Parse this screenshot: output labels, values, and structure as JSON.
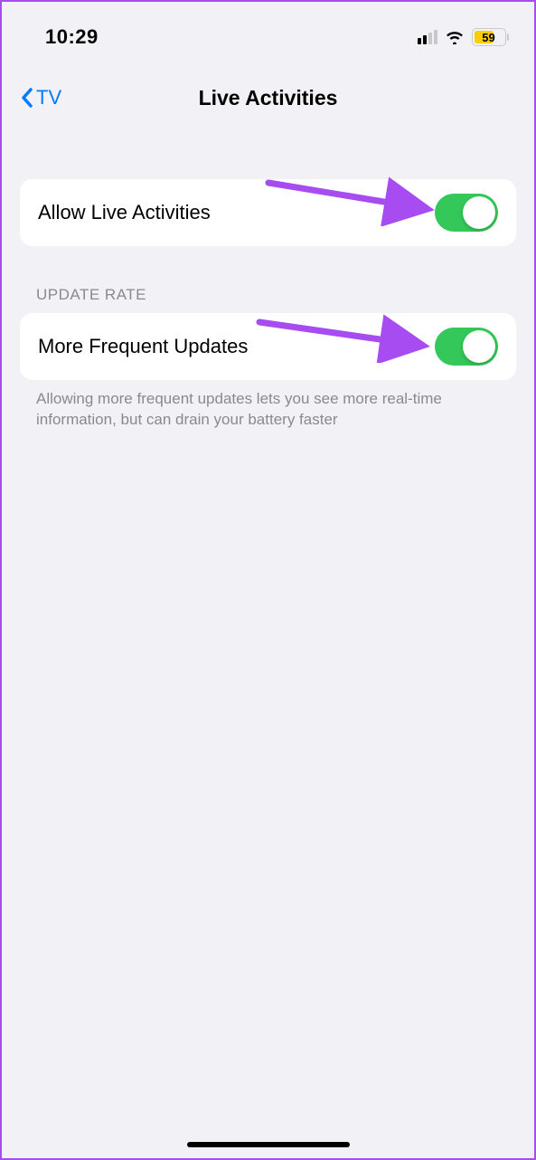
{
  "status_bar": {
    "time": "10:29",
    "battery_percent": "59",
    "cellular_bars_active": 2,
    "battery_color": "#ffcc00"
  },
  "nav": {
    "back_label": "TV",
    "title": "Live Activities"
  },
  "section1": {
    "rows": [
      {
        "label": "Allow Live Activities",
        "on": true
      }
    ]
  },
  "section2": {
    "header": "UPDATE RATE",
    "rows": [
      {
        "label": "More Frequent Updates",
        "on": true
      }
    ],
    "footer": "Allowing more frequent updates lets you see more real-time information, but can drain your battery faster"
  },
  "colors": {
    "toggle_on": "#34c759",
    "accent": "#007aff",
    "annotation": "#a64cf0"
  }
}
